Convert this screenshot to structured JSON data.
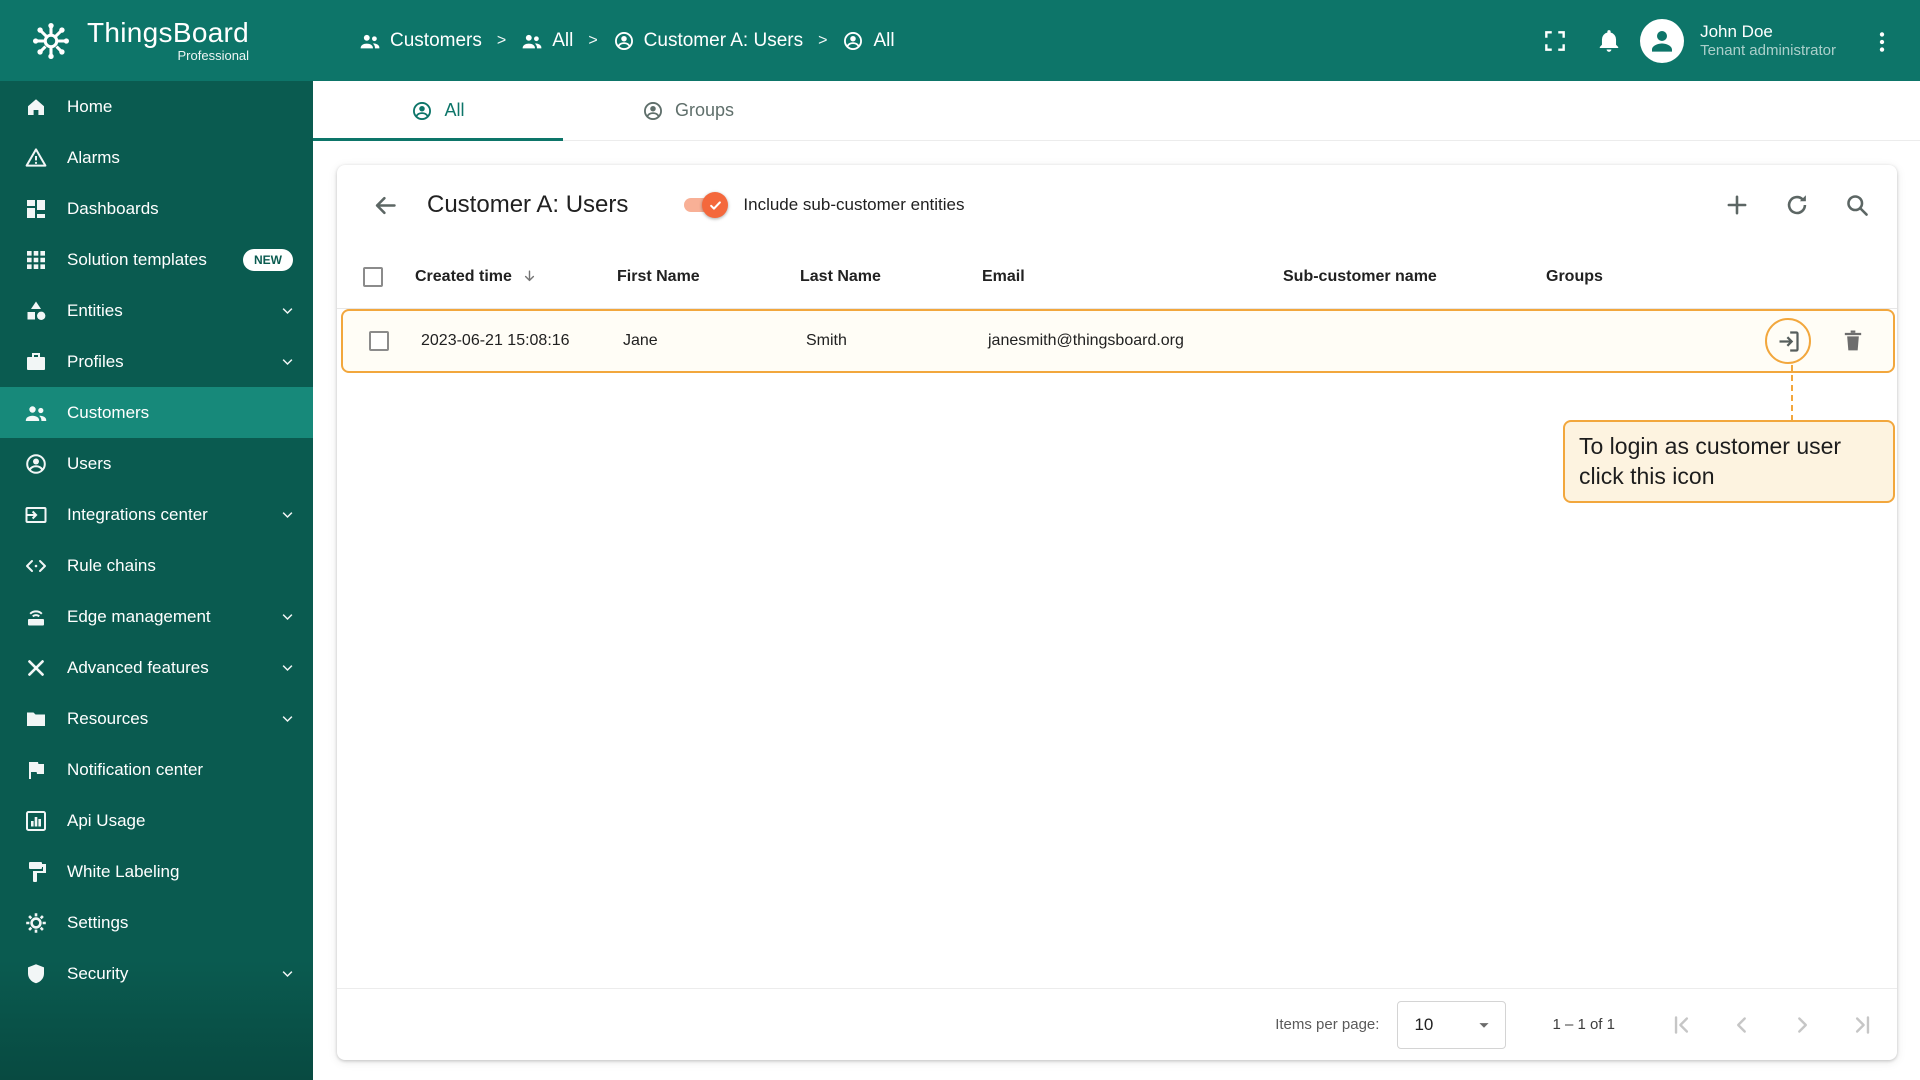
{
  "app": {
    "brand": "ThingsBoard",
    "brand_sub": "Professional"
  },
  "topbar": {
    "separator": ">",
    "breadcrumb": [
      {
        "label": "Customers",
        "icon": "customers-icon"
      },
      {
        "label": "All",
        "icon": "customers-icon"
      },
      {
        "label": "Customer A: Users",
        "icon": "user-icon"
      },
      {
        "label": "All",
        "icon": "user-icon"
      }
    ],
    "user_name": "John Doe",
    "user_role": "Tenant administrator"
  },
  "sidebar": {
    "active_item": "Customers",
    "items": [
      {
        "label": "Home",
        "icon": "home-icon"
      },
      {
        "label": "Alarms",
        "icon": "alarm-icon"
      },
      {
        "label": "Dashboards",
        "icon": "dashboards-icon"
      },
      {
        "label": "Solution templates",
        "icon": "templates-icon",
        "badge": "NEW"
      },
      {
        "label": "Entities",
        "icon": "entities-icon",
        "expandable": true
      },
      {
        "label": "Profiles",
        "icon": "profiles-icon",
        "expandable": true
      },
      {
        "label": "Customers",
        "icon": "customers-icon",
        "active": true
      },
      {
        "label": "Users",
        "icon": "user-icon"
      },
      {
        "label": "Integrations center",
        "icon": "integrations-icon",
        "expandable": true
      },
      {
        "label": "Rule chains",
        "icon": "rule-chains-icon"
      },
      {
        "label": "Edge management",
        "icon": "edge-icon",
        "expandable": true
      },
      {
        "label": "Advanced features",
        "icon": "advanced-icon",
        "expandable": true
      },
      {
        "label": "Resources",
        "icon": "resources-icon",
        "expandable": true
      },
      {
        "label": "Notification center",
        "icon": "notification-icon"
      },
      {
        "label": "Api Usage",
        "icon": "api-usage-icon"
      },
      {
        "label": "White Labeling",
        "icon": "white-labeling-icon"
      },
      {
        "label": "Settings",
        "icon": "settings-icon"
      },
      {
        "label": "Security",
        "icon": "security-icon",
        "expandable": true
      }
    ]
  },
  "tabs": {
    "all": "All",
    "groups": "Groups",
    "active": "All"
  },
  "toolbar": {
    "title": "Customer A: Users",
    "toggle_label": "Include sub-customer entities",
    "toggle_on": true
  },
  "table": {
    "headers": {
      "created": "Created time",
      "first": "First Name",
      "last": "Last Name",
      "email": "Email",
      "sub": "Sub-customer name",
      "groups": "Groups"
    },
    "rows": [
      {
        "created": "2023-06-21 15:08:16",
        "first": "Jane",
        "last": "Smith",
        "email": "janesmith@thingsboard.org",
        "sub": "",
        "groups": ""
      }
    ]
  },
  "callout": {
    "line1": "To login as customer user",
    "line2": "click this icon"
  },
  "pagination": {
    "items_per_page_label": "Items per page:",
    "page_size": "10",
    "range_label": "1 – 1 of 1"
  },
  "colors": {
    "header_bg": "#0d7569",
    "sidebar_bg": "#0a5b50",
    "sidebar_active_bg": "#17897a",
    "accent": "#0d7569",
    "toggle_orange": "#f4683c",
    "highlight_border": "#f2a73d",
    "callout_bg": "#fdf3e0"
  }
}
